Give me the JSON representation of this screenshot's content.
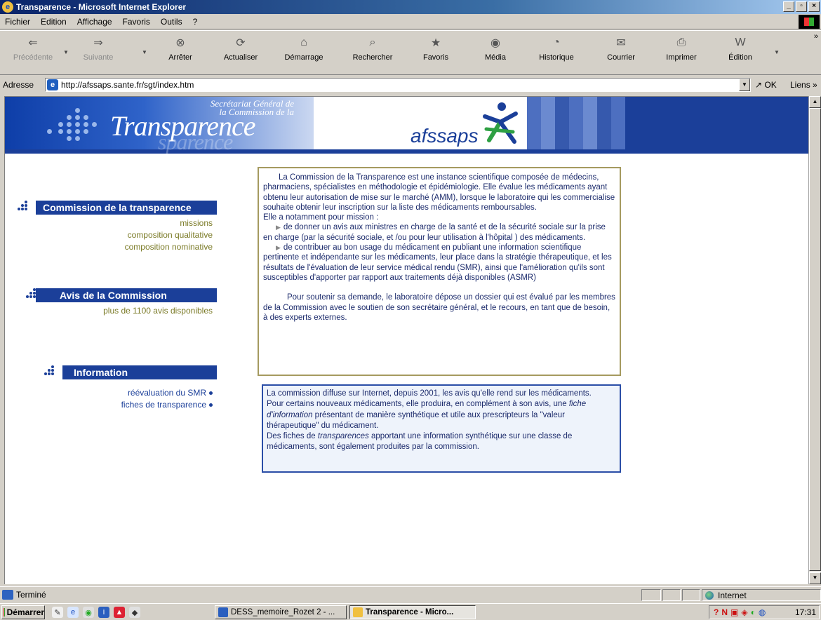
{
  "window": {
    "title": "Transparence - Microsoft Internet Explorer"
  },
  "menu": [
    "Fichier",
    "Edition",
    "Affichage",
    "Favoris",
    "Outils",
    "?"
  ],
  "toolbar": {
    "back": "Précédente",
    "forward": "Suivante",
    "stop": "Arrêter",
    "refresh": "Actualiser",
    "home": "Démarrage",
    "search": "Rechercher",
    "favorites": "Favoris",
    "media": "Média",
    "history": "Historique",
    "mail": "Courrier",
    "print": "Imprimer",
    "edit": "Édition"
  },
  "address": {
    "label": "Adresse",
    "url": "http://afssaps.sante.fr/sgt/index.htm",
    "go": "OK",
    "links": "Liens"
  },
  "banner": {
    "sg_line1": "Secrétariat Général de",
    "sg_line2": "la Commission de la",
    "logo_word": "Transparence",
    "afssaps": "afssaps"
  },
  "sections": {
    "commission": {
      "title": "Commission de la  transparence",
      "links": [
        "missions",
        "composition qualitative",
        "composition nominative"
      ]
    },
    "avis": {
      "title": "Avis de la Commission",
      "links": [
        "plus de 1100 avis disponibles"
      ]
    },
    "information": {
      "title": "Information",
      "links": [
        "réévaluation du SMR",
        "fiches de transparence"
      ]
    }
  },
  "box1": {
    "intro": "La Commission de la Transparence  est une instance scientifique composée de médecins, pharmaciens, spécialistes en méthodologie et épidémiologie. Elle évalue  les médicaments ayant obtenu leur autorisation de mise sur le marché (AMM), lorsque le laboratoire qui les commercialise souhaite obtenir leur inscription sur la liste des médicaments remboursables.",
    "mission_lead": "Elle a notamment pour mission :",
    "mission1": "de donner un avis aux ministres en charge de la santé et de la sécurité sociale sur la prise en charge (par la sécurité sociale, et /ou pour leur utilisation à l'hôpital ) des médicaments.",
    "mission2": "de contribuer au bon usage du médicament en publiant une information scientifique pertinente et indépendante sur les médicaments, leur place dans la stratégie thérapeutique, et les résultats de l'évaluation de leur service médical rendu (SMR), ainsi que l'amélioration qu'ils sont susceptibles d'apporter par rapport aux traitements déjà disponibles (ASMR)",
    "dossier": "Pour soutenir sa demande, le laboratoire dépose un dossier qui est évalué par les membres de la Commission avec le soutien de son secrétaire général, et le recours, en tant que de besoin, à des experts externes."
  },
  "box2": {
    "p1": "La commission diffuse sur Internet, depuis 2001, les avis qu'elle rend sur les médicaments.",
    "p2a": "Pour  certains nouveaux médicaments, elle produira, en complément à son avis, une ",
    "p2_italic": "fiche d'information",
    "p2b": " présentant de manière synthétique et utile aux prescripteurs la \"valeur thérapeutique\" du médicament.",
    "p3a": "Des fiches de ",
    "p3_italic": "transparences",
    "p3b": " apportant une information synthétique sur une classe de médicaments, sont également produites par la commission."
  },
  "status": {
    "text": "Terminé",
    "zone": "Internet"
  },
  "taskbar": {
    "start": "Démarrer",
    "task1": "DESS_memoire_Rozet 2 - ...",
    "task2": "Transparence - Micro...",
    "clock": "17:31"
  }
}
